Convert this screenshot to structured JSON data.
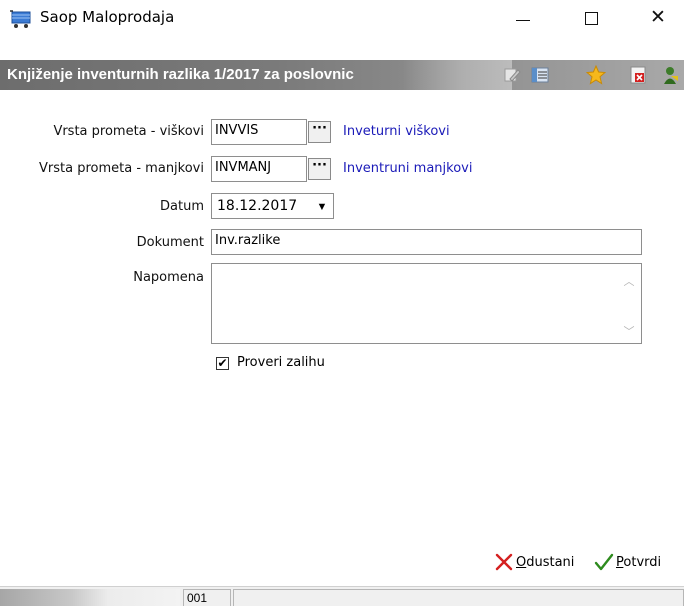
{
  "window": {
    "title": "Saop Maloprodaja",
    "minimize_label": "—",
    "close_label": "✕"
  },
  "caption": {
    "text": "Knjiženje inventurnih razlika 1/2017 za poslovnic"
  },
  "form": {
    "vrsta_visak": {
      "label": "Vrsta prometa - viškovi",
      "value": "INVVIS",
      "button": "···",
      "description": "Inveturni viškovi"
    },
    "vrsta_manjak": {
      "label": "Vrsta prometa - manjkovi",
      "value": "INVMANJ",
      "button": "···",
      "description": "Inventruni manjkovi"
    },
    "datum": {
      "label": "Datum",
      "value": "18.12.2017",
      "dropdown_glyph": "▼"
    },
    "dokument": {
      "label": "Dokument",
      "value": "Inv.razlike"
    },
    "napomena": {
      "label": "Napomena",
      "value": ""
    },
    "proveri_zalihu": {
      "label": "Proveri zalihu",
      "checked": true,
      "check_glyph": "✔"
    }
  },
  "actions": {
    "cancel": {
      "mnemonic": "O",
      "rest": "dustani"
    },
    "confirm": {
      "mnemonic": "P",
      "rest": "otvrdi"
    }
  },
  "statusbar": {
    "code": "001"
  },
  "colors": {
    "caption_band": "#7a7a7a",
    "link": "#1a1ab8",
    "cancel_icon": "#d42020",
    "confirm_icon": "#2e8b1e"
  },
  "icons": {
    "app": "shopping-cart-icon",
    "toolbar": [
      "edit-icon",
      "list-icon",
      "star-icon",
      "delete-icon",
      "exit-icon"
    ]
  }
}
